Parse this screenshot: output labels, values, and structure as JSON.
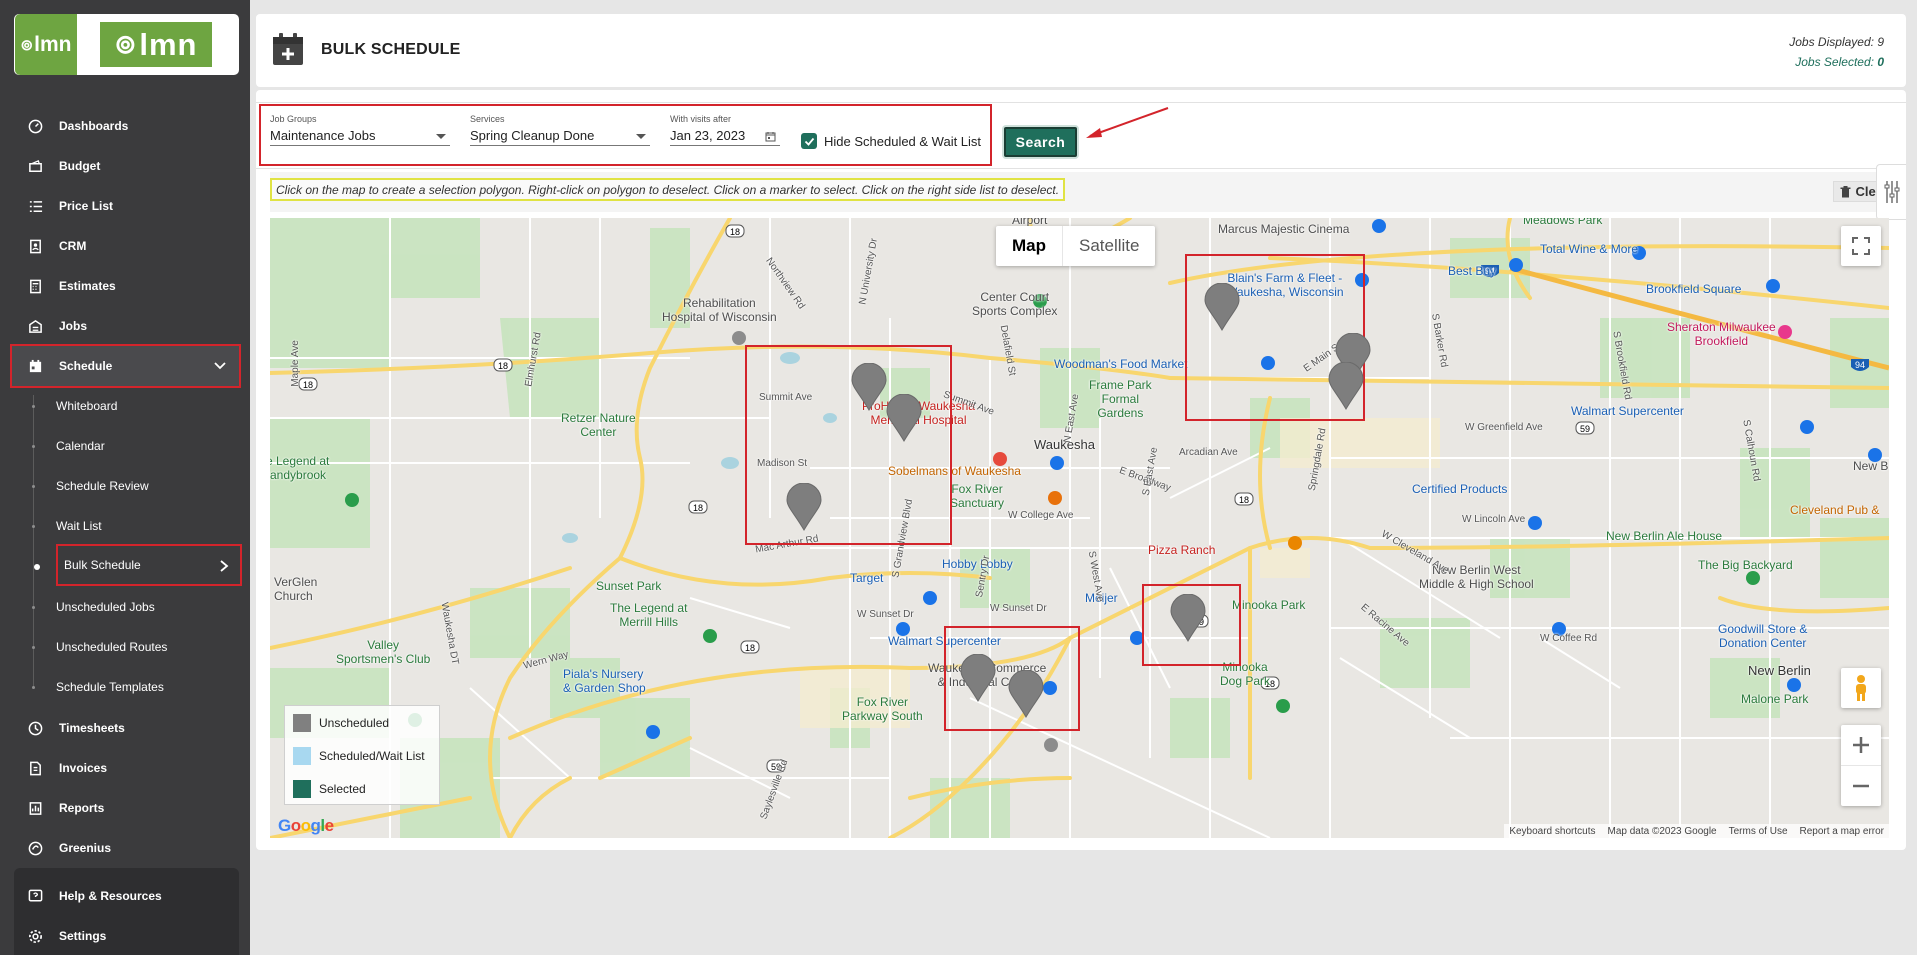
{
  "brand": {
    "mini": "lmn",
    "main": "lmn"
  },
  "nav": {
    "items": [
      {
        "label": "Dashboards",
        "icon": "gauge-icon"
      },
      {
        "label": "Budget",
        "icon": "budget-icon"
      },
      {
        "label": "Price List",
        "icon": "list-icon"
      },
      {
        "label": "CRM",
        "icon": "contact-icon"
      },
      {
        "label": "Estimates",
        "icon": "calculator-icon"
      },
      {
        "label": "Jobs",
        "icon": "jobs-icon"
      },
      {
        "label": "Schedule",
        "icon": "calendar-icon"
      }
    ],
    "schedule_sub": [
      "Whiteboard",
      "Calendar",
      "Schedule Review",
      "Wait List",
      "Bulk Schedule",
      "Unscheduled Jobs",
      "Unscheduled Routes",
      "Schedule Templates"
    ],
    "lower_items": [
      {
        "label": "Timesheets",
        "icon": "clock-icon"
      },
      {
        "label": "Invoices",
        "icon": "invoice-icon"
      },
      {
        "label": "Reports",
        "icon": "report-icon"
      },
      {
        "label": "Greenius",
        "icon": "greenius-icon"
      }
    ],
    "bottom_items": [
      {
        "label": "Help & Resources",
        "icon": "help-icon"
      },
      {
        "label": "Settings",
        "icon": "gear-icon"
      }
    ]
  },
  "header": {
    "title": "BULK SCHEDULE",
    "jobs_displayed_label": "Jobs Displayed:",
    "jobs_displayed_value": "9",
    "jobs_selected_label": "Jobs Selected:",
    "jobs_selected_value": "0"
  },
  "filters": {
    "job_groups_label": "Job Groups",
    "job_groups_value": "Maintenance Jobs",
    "services_label": "Services",
    "services_value": "Spring Cleanup Done",
    "visits_label": "With visits after",
    "visits_value": "Jan 23, 2023",
    "hide_label": "Hide Scheduled & Wait List",
    "hide_checked": true,
    "search_label": "Search"
  },
  "instructions": "Click on the map to create a selection polygon. Right-click on polygon to deselect. Click on a marker to select. Click on the right side list to deselect.",
  "clear_label": "Clear",
  "map": {
    "type_map": "Map",
    "type_satellite": "Satellite",
    "legend": {
      "unscheduled": "Unscheduled",
      "scheduled": "Scheduled/Wait List",
      "selected": "Selected"
    },
    "legend_colors": {
      "unscheduled": "#808080",
      "scheduled": "#a8d8f0",
      "selected": "#1f6f5c"
    },
    "footer": [
      "Keyboard shortcuts",
      "Map data ©2023 Google",
      "Terms of Use",
      "Report a map error"
    ],
    "labels": {
      "airport": "Airport",
      "marcus": "Marcus Majestic Cinema",
      "meadows": "Meadows Park",
      "rehab": "Rehabilitation\nHospital of Wisconsin",
      "center_court": "Center Court\nSports Complex",
      "blains": "Blain's Farm & Fleet -\nWaukesha, Wisconsin",
      "best_buy": "Best Buy",
      "total_wine": "Total Wine & More",
      "brookfield_sq": "Brookfield Square",
      "sheraton": "Sheraton Milwaukee\nBrookfield",
      "woodmans": "Woodman's Food Market",
      "frame_park": "Frame Park\nFormal\nGardens",
      "prohealth": "ProHealth Waukesha\nMemorial Hospital",
      "retzer": "Retzer Nature\nCenter",
      "waukesha": "Waukesha",
      "walmart_sc": "Walmart Supercenter",
      "legend_brandybrook": "e Legend at\nrandybrook",
      "sobelmans": "Sobelmans of Waukesha",
      "fox_river_sanct": "Fox River\nSanctuary",
      "certified": "Certified Products",
      "new_berlin": "New B",
      "new_berlin_house": "New Berlin Ale House",
      "cleveland_pub": "Cleveland Pub &",
      "pizza_ranch": "Pizza Ranch",
      "big_backyard": "The Big Backyard",
      "nb_west": "New Berlin West\nMiddle & High School",
      "target": "Target",
      "hobby_lobby": "Hobby Lobby",
      "meijer": "Meijer",
      "minooka_park": "Minooka Park",
      "goodwill": "Goodwill Store &\nDonation Center",
      "veerglen": "VerGlen\nChurch",
      "sunset_park": "Sunset Park",
      "legend_merrill": "The Legend at\nMerrill Hills",
      "walmart_sc2": "Walmart Supercenter",
      "minooka_dog": "Minooka\nDog Park",
      "sportsmens": "Valley\nSportsmen's Club",
      "pialas": "Piala's Nursery\n& Garden Shop",
      "waukesha_commerce": "Waukesha Commerce\n& Industrial Center",
      "fox_river_pkwy": "Fox River\nParkway South",
      "new_berlin_city": "New Berlin",
      "malone": "Malone Park"
    },
    "roads": {
      "summit_ave": "Summit Ave",
      "summit_ave2": "Summit Ave",
      "madison": "Madison St",
      "w_greenfield": "W Greenfield Ave",
      "w_lincoln": "W Lincoln Ave",
      "e_broadway": "E Broadway",
      "w_college": "W College Ave",
      "w_sunset": "W Sunset Dr",
      "w_sunset2": "W Sunset Dr",
      "mac_arthur": "Mac Arthur Rd",
      "wern_way": "Wern Way",
      "w_coffee": "W Coffee Rd",
      "arcadian": "Arcadian Ave",
      "e_main": "E Main St",
      "w_cleveland": "W Cleveland Ave",
      "e_racine": "E Racine Ave",
      "maple": "Maple Ave",
      "elmhurst": "Elmhurst Rd",
      "northview": "Northview Rd",
      "n_university": "N University Dr",
      "delafield": "Delafield St",
      "n_east": "N East Ave",
      "s_east": "S East Ave",
      "s_west": "S West Ave",
      "sentry": "Sentry Dr",
      "s_grandview": "S Grandview Blvd",
      "springdale": "Springdale Rd",
      "s_barker": "S Barker Rd",
      "s_brookfield": "S Brookfield Rd",
      "s_calhoun": "S Calhoun Rd",
      "waukesha_dr": "Waukesha DT",
      "saylesville": "Saylesville Rd"
    },
    "shields": [
      "18",
      "18",
      "18",
      "18",
      "18",
      "18",
      "59",
      "59",
      "59",
      "94",
      "94",
      "18"
    ]
  }
}
